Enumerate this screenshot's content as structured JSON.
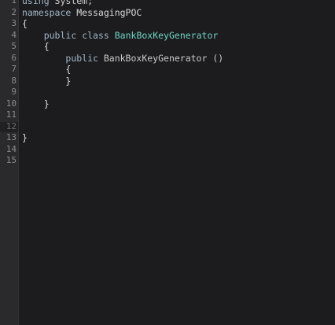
{
  "editor": {
    "lines": [
      {
        "n": "1",
        "indent": "",
        "tokens": [
          {
            "t": "using",
            "c": "kw"
          },
          {
            "t": " System;",
            "c": "plain"
          }
        ]
      },
      {
        "n": "2",
        "indent": "",
        "tokens": [
          {
            "t": "namespace",
            "c": "kw"
          },
          {
            "t": " MessagingPOC",
            "c": "id"
          }
        ]
      },
      {
        "n": "3",
        "indent": "",
        "tokens": [
          {
            "t": "{",
            "c": "punc"
          }
        ]
      },
      {
        "n": "4",
        "indent": "    ",
        "tokens": [
          {
            "t": "public",
            "c": "kw"
          },
          {
            "t": " ",
            "c": "plain"
          },
          {
            "t": "class",
            "c": "kw"
          },
          {
            "t": " ",
            "c": "plain"
          },
          {
            "t": "BankBoxKeyGenerator",
            "c": "cls"
          }
        ]
      },
      {
        "n": "5",
        "indent": "    ",
        "tokens": [
          {
            "t": "{",
            "c": "punc"
          }
        ]
      },
      {
        "n": "6",
        "indent": "        ",
        "tokens": [
          {
            "t": "public",
            "c": "kw"
          },
          {
            "t": " BankBoxKeyGenerator ()",
            "c": "ctor"
          }
        ]
      },
      {
        "n": "7",
        "indent": "        ",
        "tokens": [
          {
            "t": "{",
            "c": "punc"
          }
        ]
      },
      {
        "n": "8",
        "indent": "        ",
        "tokens": [
          {
            "t": "}",
            "c": "punc"
          }
        ]
      },
      {
        "n": "9",
        "indent": "",
        "tokens": []
      },
      {
        "n": "10",
        "indent": "    ",
        "tokens": [
          {
            "t": "}",
            "c": "punc"
          }
        ]
      },
      {
        "n": "11",
        "indent": "",
        "tokens": []
      },
      {
        "n": "12",
        "indent": "",
        "tokens": [],
        "current": true
      },
      {
        "n": "13",
        "indent": "",
        "tokens": [
          {
            "t": "}",
            "c": "punc"
          }
        ]
      },
      {
        "n": "14",
        "indent": "",
        "tokens": []
      },
      {
        "n": "15",
        "indent": "",
        "tokens": []
      }
    ]
  },
  "colors": {
    "background": "#1c1c1e",
    "gutter": "#2a2a2c",
    "keyword": "#9fb6c8",
    "class_name": "#6fd3c6",
    "line_number": "#8a8a8e"
  }
}
